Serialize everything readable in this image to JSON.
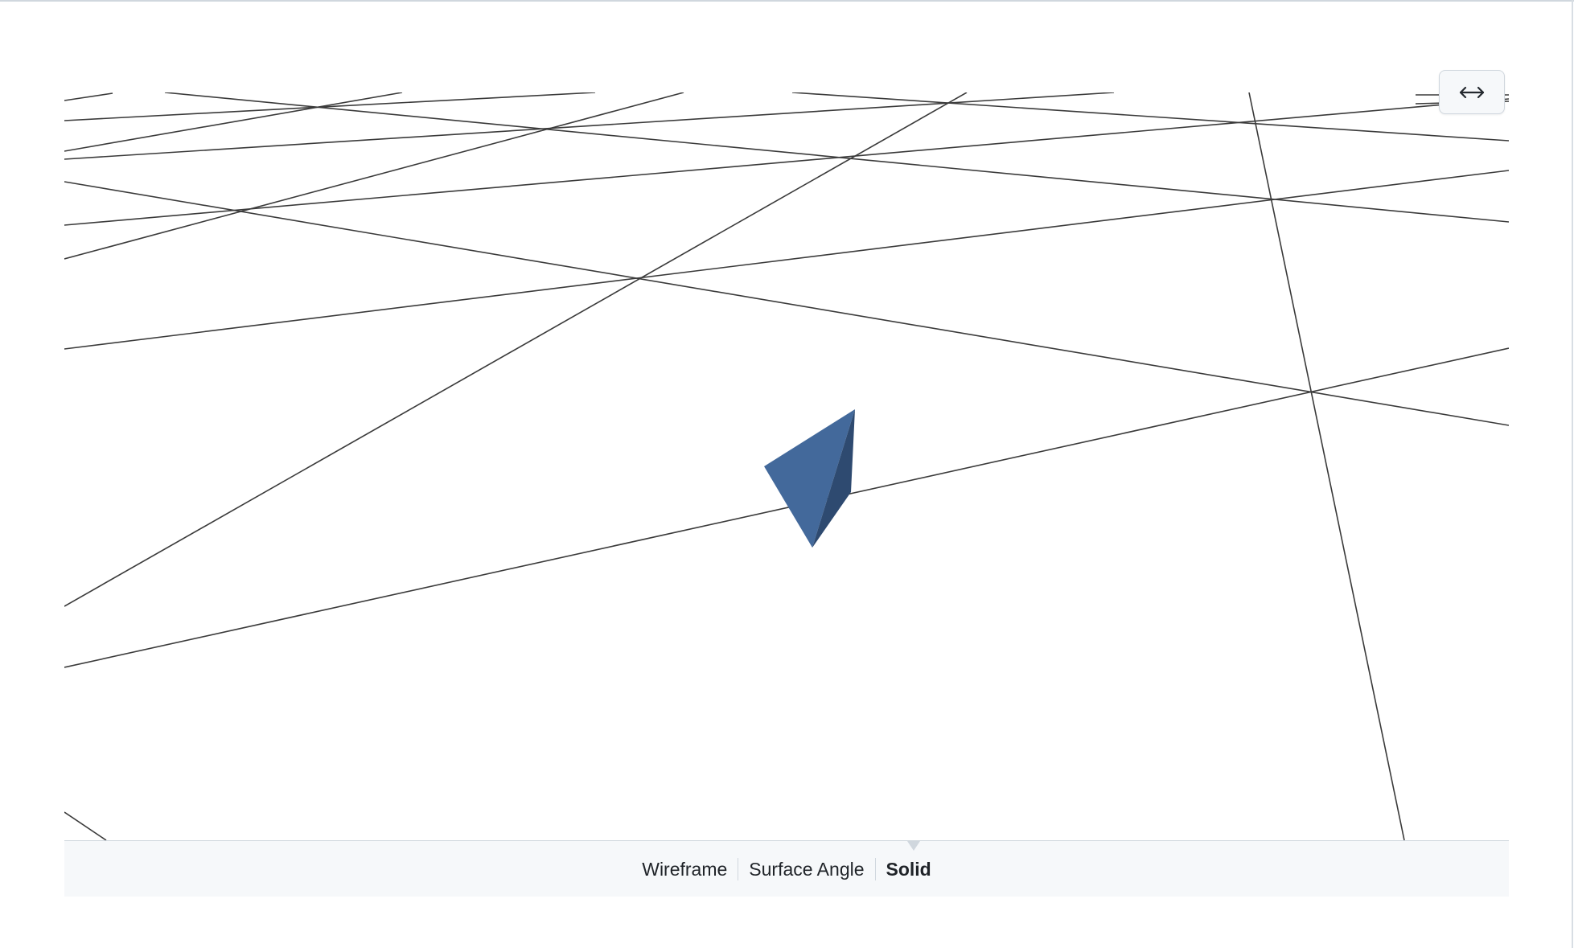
{
  "viewer": {
    "expand_icon": "arrows-left-right-icon",
    "expand_glyph": "⟷",
    "model_color": "#43699b",
    "model_shadow_color": "#2e4a70",
    "grid_line_color": "#3a3a3a"
  },
  "view_modes": {
    "items": [
      {
        "label": "Wireframe",
        "active": false
      },
      {
        "label": "Surface Angle",
        "active": false
      },
      {
        "label": "Solid",
        "active": true
      }
    ]
  }
}
